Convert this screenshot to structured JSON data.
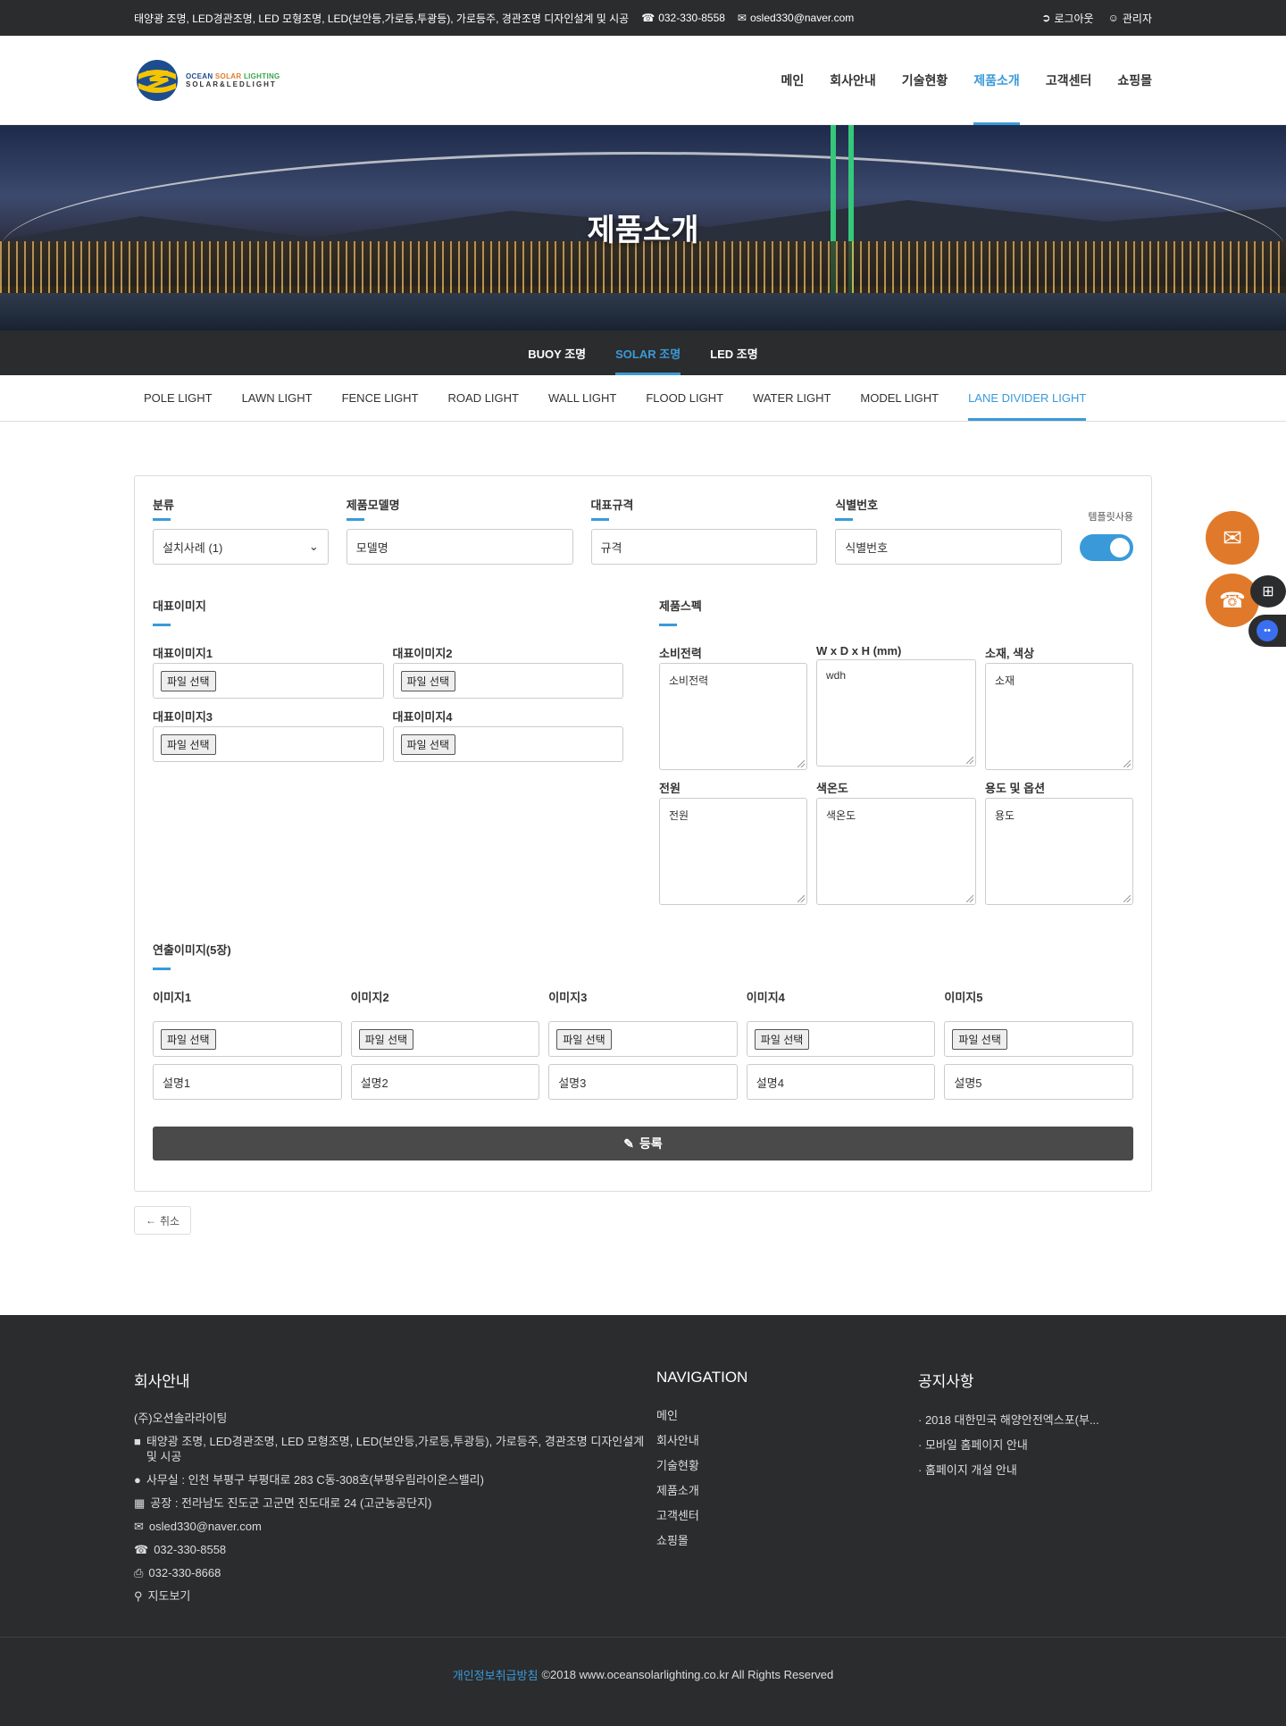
{
  "topbar": {
    "tagline": "태양광 조명, LED경관조명, LED 모형조명, LED(보안등,가로등,투광등), 가로등주, 경관조명 디자인설계 및 시공",
    "phone": "032-330-8558",
    "email": "osled330@naver.com",
    "logout": "로그아웃",
    "admin": "관리자"
  },
  "logo": {
    "line1a": "OCEAN ",
    "line1b": "SOLAR ",
    "line1c": "LIGHTING",
    "line2": "SOLAR&LEDLIGHT"
  },
  "nav": [
    "메인",
    "회사안내",
    "기술현황",
    "제품소개",
    "고객센터",
    "쇼핑몰"
  ],
  "hero": {
    "title": "제품소개"
  },
  "subnav1": [
    "BUOY 조명",
    "SOLAR 조명",
    "LED 조명"
  ],
  "subnav2": [
    "POLE LIGHT",
    "LAWN LIGHT",
    "FENCE LIGHT",
    "ROAD LIGHT",
    "WALL LIGHT",
    "FLOOD LIGHT",
    "WATER LIGHT",
    "MODEL LIGHT",
    "LANE DIVIDER LIGHT"
  ],
  "form": {
    "category_label": "분류",
    "category_value": "설치사례 (1)",
    "model_label": "제품모델명",
    "model_ph": "모델명",
    "spec_label": "대표규격",
    "spec_ph": "규격",
    "id_label": "식별번호",
    "id_ph": "식별번호",
    "template_label": "템플릿사용",
    "rep_images_title": "대표이미지",
    "rep_images": [
      "대표이미지1",
      "대표이미지2",
      "대표이미지3",
      "대표이미지4"
    ],
    "file_button": "파일 선택",
    "spec_title": "제품스펙",
    "specs": [
      {
        "label": "소비전력",
        "ph": "소비전력"
      },
      {
        "label": "W x D x H (mm)",
        "ph": "wdh"
      },
      {
        "label": "소재, 색상",
        "ph": "소재"
      },
      {
        "label": "전원",
        "ph": "전원"
      },
      {
        "label": "색온도",
        "ph": "색온도"
      },
      {
        "label": "용도 및 옵션",
        "ph": "용도"
      }
    ],
    "gallery_title": "연출이미지(5장)",
    "gallery": [
      {
        "label": "이미지1",
        "desc": "설명1"
      },
      {
        "label": "이미지2",
        "desc": "설명2"
      },
      {
        "label": "이미지3",
        "desc": "설명3"
      },
      {
        "label": "이미지4",
        "desc": "설명4"
      },
      {
        "label": "이미지5",
        "desc": "설명5"
      }
    ],
    "submit": "등록",
    "cancel": "취소"
  },
  "footer": {
    "company_title": "회사안내",
    "company_name": "(주)오션솔라라이팅",
    "business": "태양광 조명, LED경관조명, LED 모형조명, LED(보안등,가로등,투광등), 가로등주, 경관조명 디자인설계 및 시공",
    "office": "사무실 : 인천 부평구 부평대로 283 C동-308호(부평우림라이온스밸리)",
    "factory": "공장 : 전라남도 진도군 고군면 진도대로 24 (고군농공단지)",
    "email": "osled330@naver.com",
    "phone": "032-330-8558",
    "fax": "032-330-8668",
    "map": "지도보기",
    "nav_title": "NAVIGATION",
    "nav": [
      "메인",
      "회사안내",
      "기술현황",
      "제품소개",
      "고객센터",
      "쇼핑몰"
    ],
    "notice_title": "공지사항",
    "notices": [
      "2018 대한민국 해양안전엑스포(부...",
      "모바일 홈페이지 안내",
      "홈페이지 개설 안내"
    ],
    "privacy": "개인정보취급방침",
    "copyright": "©2018 www.oceansolarlighting.co.kr All Rights Reserved"
  },
  "colors": {
    "accent": "#3a9ad9",
    "dark": "#2b2c2e",
    "orange": "#e07a2a"
  }
}
